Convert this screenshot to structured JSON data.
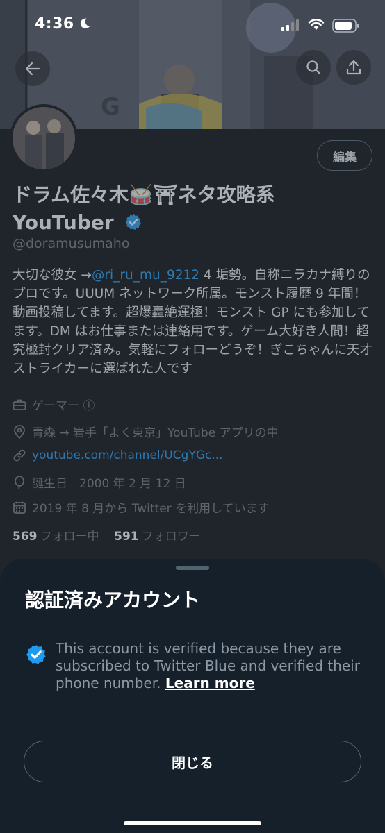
{
  "status_bar": {
    "time": "4:36"
  },
  "profile": {
    "edit_label": "編集",
    "name_line1": "ドラム佐々木🥁⛩ネタ攻略系",
    "name_line2": "YouTuber",
    "handle": "@doramusumaho",
    "bio_part1": "大切な彼女 →",
    "bio_mention": "@ri_ru_mu_9212",
    "bio_part2": " 4 垢勢。自称ニラカナ縛りのプロです。UUUM ネットワーク所属。モンスト履歴 9 年間！動画投稿してます。超爆轟絶運極！モンスト GP にも参加してます。DM はお仕事または連絡用です。ゲーム大好き人間！超究極封クリア済み。気軽にフォローどうぞ！ぎこちゃんに天才ストライカーに選ばれた人です",
    "category": "ゲーマー ⓘ",
    "location": "青森 → 岩手「よく東京」YouTube アプリの中",
    "website": "youtube.com/channel/UCgYGc...",
    "birthday": "誕生日　2000 年 2 月 12 日",
    "joined": "2019 年 8 月から Twitter を利用しています",
    "following_count": "569",
    "following_label": "フォロー中",
    "followers_count": "591",
    "followers_label": "フォロワー"
  },
  "sheet": {
    "title": "認証済みアカウント",
    "body": "This account is verified because they are subscribed to Twitter Blue and verified their phone number. ",
    "learn_more": "Learn more",
    "close_label": "閉じる"
  },
  "colors": {
    "accent": "#1d9bf0",
    "sheet_bg": "#15202b",
    "muted": "#71767b"
  }
}
